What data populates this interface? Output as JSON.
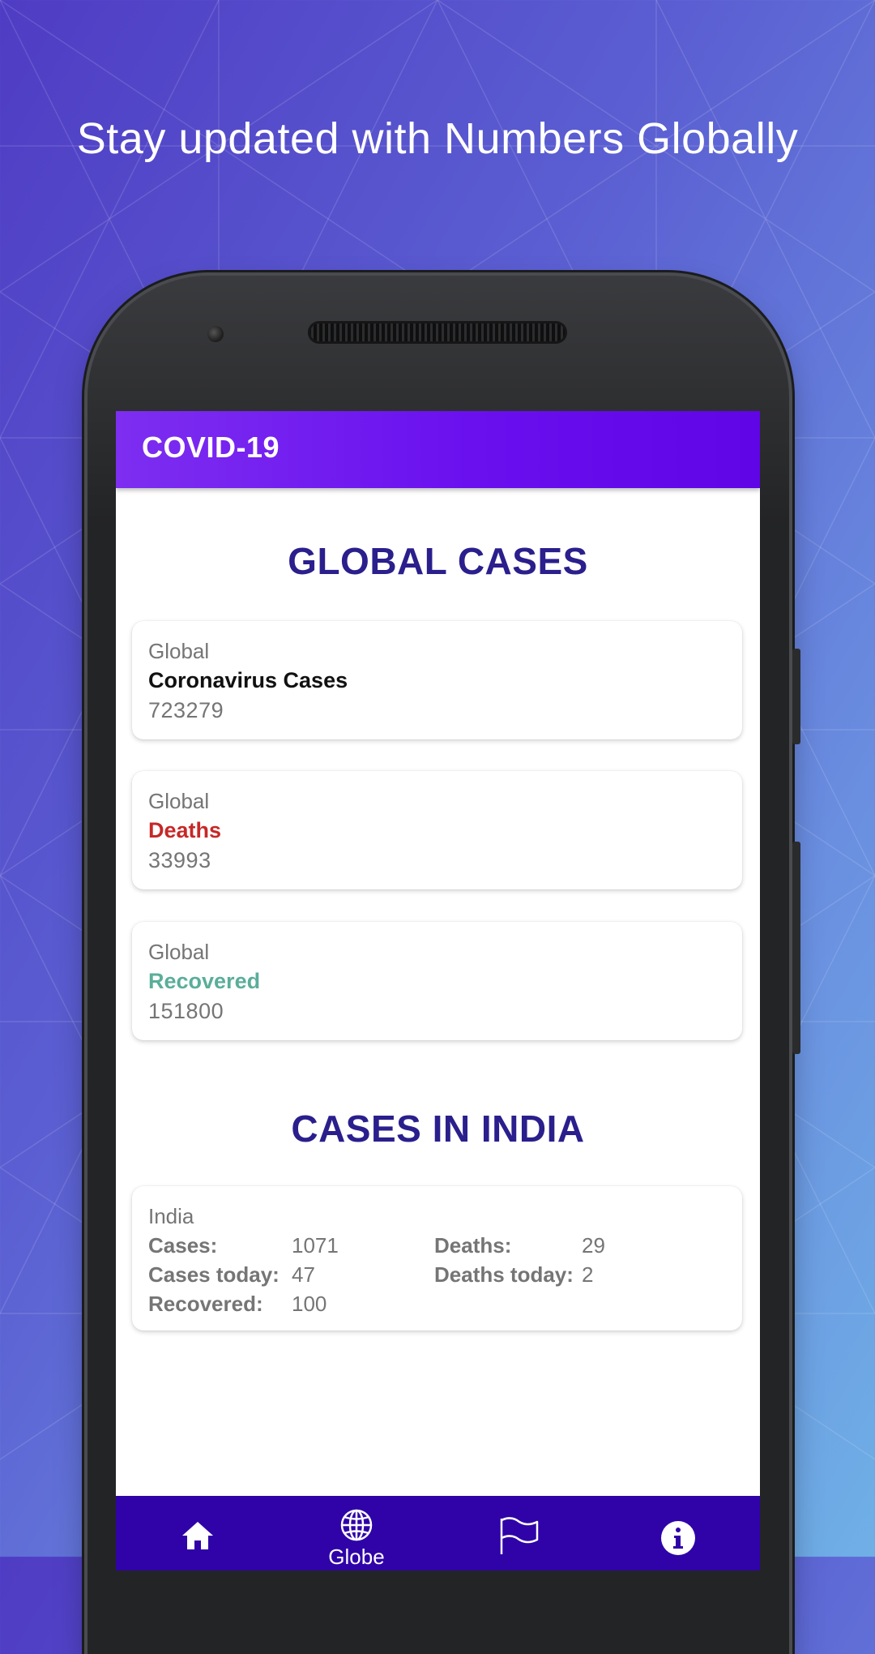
{
  "promo": {
    "headline": "Stay updated with Numbers Globally"
  },
  "app": {
    "title": "COVID-19",
    "accent": "#6a10ef",
    "nav_color": "#2f03a8"
  },
  "global": {
    "section_title": "GLOBAL CASES",
    "cards": [
      {
        "label": "Global",
        "title": "Coronavirus Cases",
        "value": "723279",
        "title_color": "#111111"
      },
      {
        "label": "Global",
        "title": "Deaths",
        "value": "33993",
        "title_color": "#c62828"
      },
      {
        "label": "Global",
        "title": "Recovered",
        "value": "151800",
        "title_color": "#5aae9a"
      }
    ]
  },
  "india": {
    "section_title": "CASES IN INDIA",
    "label": "India",
    "cases_label": "Cases:",
    "cases": "1071",
    "deaths_label": "Deaths:",
    "deaths": "29",
    "cases_today_label": "Cases today:",
    "cases_today": "47",
    "deaths_today_label": "Deaths today:",
    "deaths_today": "2",
    "recovered_label": "Recovered:",
    "recovered": "100"
  },
  "nav": {
    "items": [
      {
        "icon": "home-icon",
        "label": ""
      },
      {
        "icon": "globe-icon",
        "label": "Globe"
      },
      {
        "icon": "flag-icon",
        "label": ""
      },
      {
        "icon": "info-icon",
        "label": ""
      }
    ]
  }
}
